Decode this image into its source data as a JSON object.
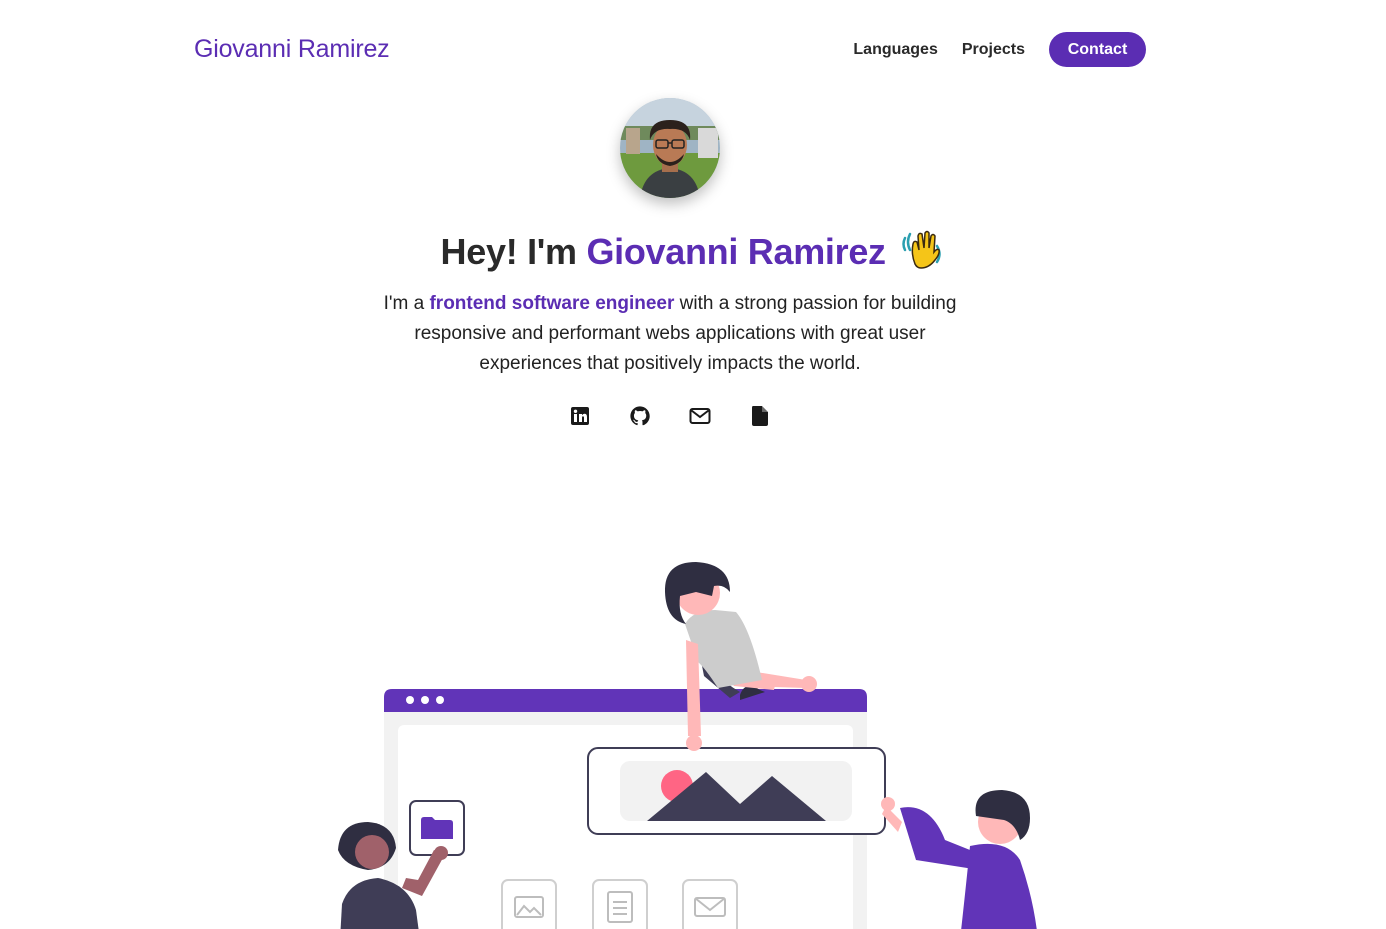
{
  "nav": {
    "brand": "Giovanni Ramirez",
    "links": [
      "Languages",
      "Projects"
    ],
    "contact_label": "Contact"
  },
  "hero": {
    "greeting": "Hey! I'm ",
    "name": "Giovanni Ramirez",
    "intro_prefix": "I'm a ",
    "intro_highlight": "frontend software engineer",
    "intro_rest": " with a strong passion for building responsive and performant webs applications with great user experiences that positively impacts the world."
  },
  "socials": [
    {
      "icon": "linkedin-icon"
    },
    {
      "icon": "github-icon"
    },
    {
      "icon": "mail-icon"
    },
    {
      "icon": "document-icon"
    }
  ],
  "colors": {
    "accent": "#5b2db3",
    "text": "#222222",
    "background": "#ffffff"
  }
}
